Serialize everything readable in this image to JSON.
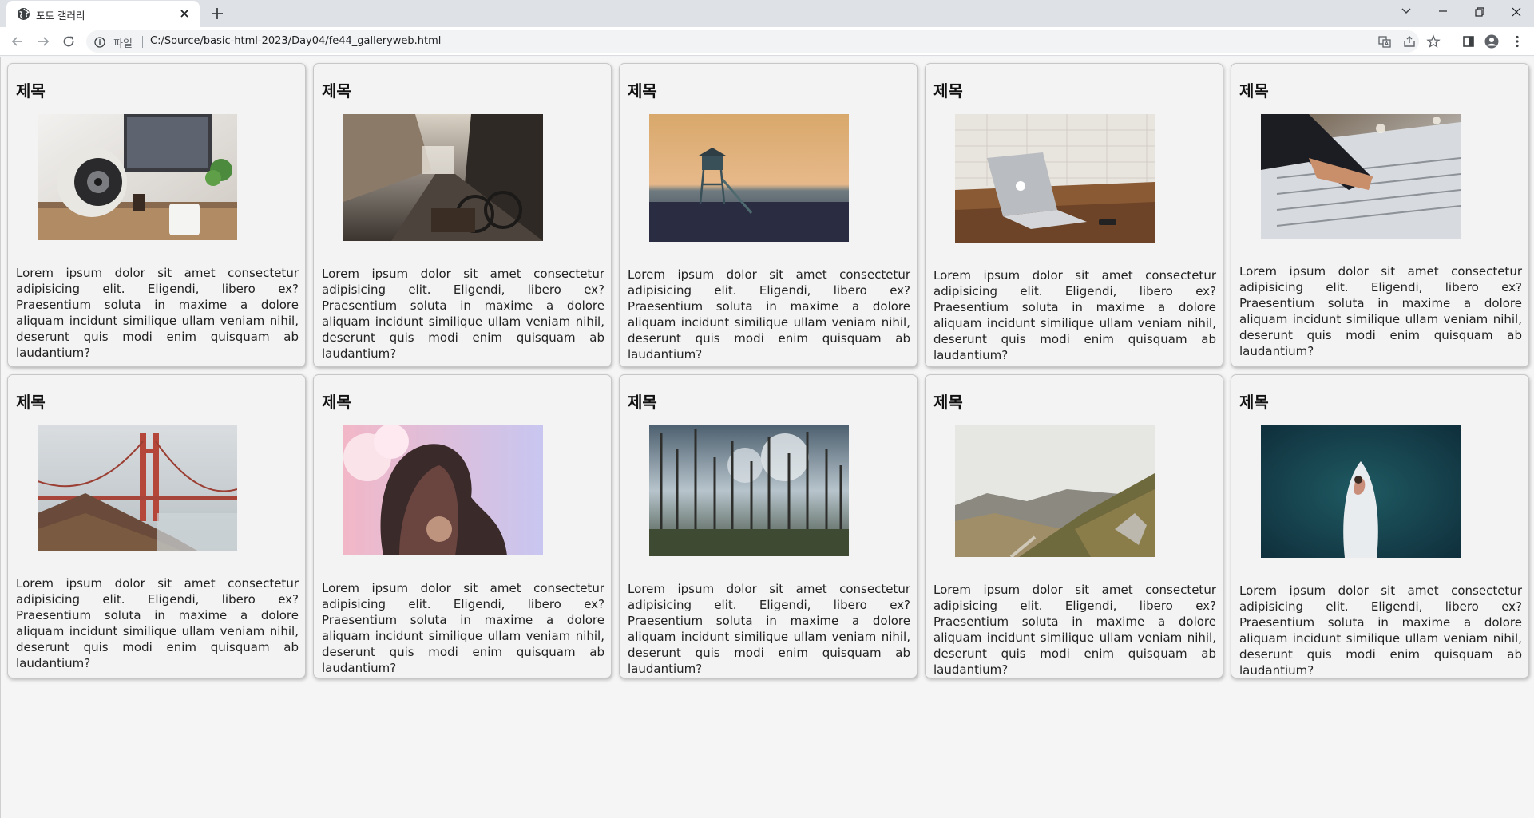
{
  "browser": {
    "tab_title": "포토 갤러리",
    "scheme_label": "파일",
    "url": "C:/Source/basic-html-2023/Day04/fe44_galleryweb.html"
  },
  "gallery": {
    "cards": [
      {
        "title": "제목",
        "photo": "desk-speaker-photo",
        "text": "Lorem ipsum dolor sit amet consectetur adipisicing elit. Eligendi, libero ex? Praesentium soluta in maxime a dolore aliquam incidunt similique ullam veniam nihil, deserunt quis modi enim quisquam ab laudantium?"
      },
      {
        "title": "제목",
        "photo": "street-bicycles-photo",
        "text": "Lorem ipsum dolor sit amet consectetur adipisicing elit. Eligendi, libero ex? Praesentium soluta in maxime a dolore aliquam incidunt similique ullam veniam nihil, deserunt quis modi enim quisquam ab laudantium?"
      },
      {
        "title": "제목",
        "photo": "lifeguard-tower-photo",
        "text": "Lorem ipsum dolor sit amet consectetur adipisicing elit. Eligendi, libero ex? Praesentium soluta in maxime a dolore aliquam incidunt similique ullam veniam nihil, deserunt quis modi enim quisquam ab laudantium?"
      },
      {
        "title": "제목",
        "photo": "laptop-table-photo",
        "text": "Lorem ipsum dolor sit amet consectetur adipisicing elit. Eligendi, libero ex? Praesentium soluta in maxime a dolore aliquam incidunt similique ullam veniam nihil, deserunt quis modi enim quisquam ab laudantium?"
      },
      {
        "title": "제목",
        "photo": "mixing-console-photo",
        "text": "Lorem ipsum dolor sit amet consectetur adipisicing elit. Eligendi, libero ex? Praesentium soluta in maxime a dolore aliquam incidunt similique ullam veniam nihil, deserunt quis modi enim quisquam ab laudantium?"
      },
      {
        "title": "제목",
        "photo": "golden-gate-photo",
        "text": "Lorem ipsum dolor sit amet consectetur adipisicing elit. Eligendi, libero ex? Praesentium soluta in maxime a dolore aliquam incidunt similique ullam veniam nihil, deserunt quis modi enim quisquam ab laudantium?"
      },
      {
        "title": "제목",
        "photo": "woman-sky-photo",
        "text": "Lorem ipsum dolor sit amet consectetur adipisicing elit. Eligendi, libero ex? Praesentium soluta in maxime a dolore aliquam incidunt similique ullam veniam nihil, deserunt quis modi enim quisquam ab laudantium?"
      },
      {
        "title": "제목",
        "photo": "dead-forest-photo",
        "text": "Lorem ipsum dolor sit amet consectetur adipisicing elit. Eligendi, libero ex? Praesentium soluta in maxime a dolore aliquam incidunt similique ullam veniam nihil, deserunt quis modi enim quisquam ab laudantium?"
      },
      {
        "title": "제목",
        "photo": "mountain-valley-photo",
        "text": "Lorem ipsum dolor sit amet consectetur adipisicing elit. Eligendi, libero ex? Praesentium soluta in maxime a dolore aliquam incidunt similique ullam veniam nihil, deserunt quis modi enim quisquam ab laudantium?"
      },
      {
        "title": "제목",
        "photo": "surfboard-ocean-photo",
        "text": "Lorem ipsum dolor sit amet consectetur adipisicing elit. Eligendi, libero ex? Praesentium soluta in maxime a dolore aliquam incidunt similique ullam veniam nihil, deserunt quis modi enim quisquam ab laudantium?"
      }
    ]
  }
}
